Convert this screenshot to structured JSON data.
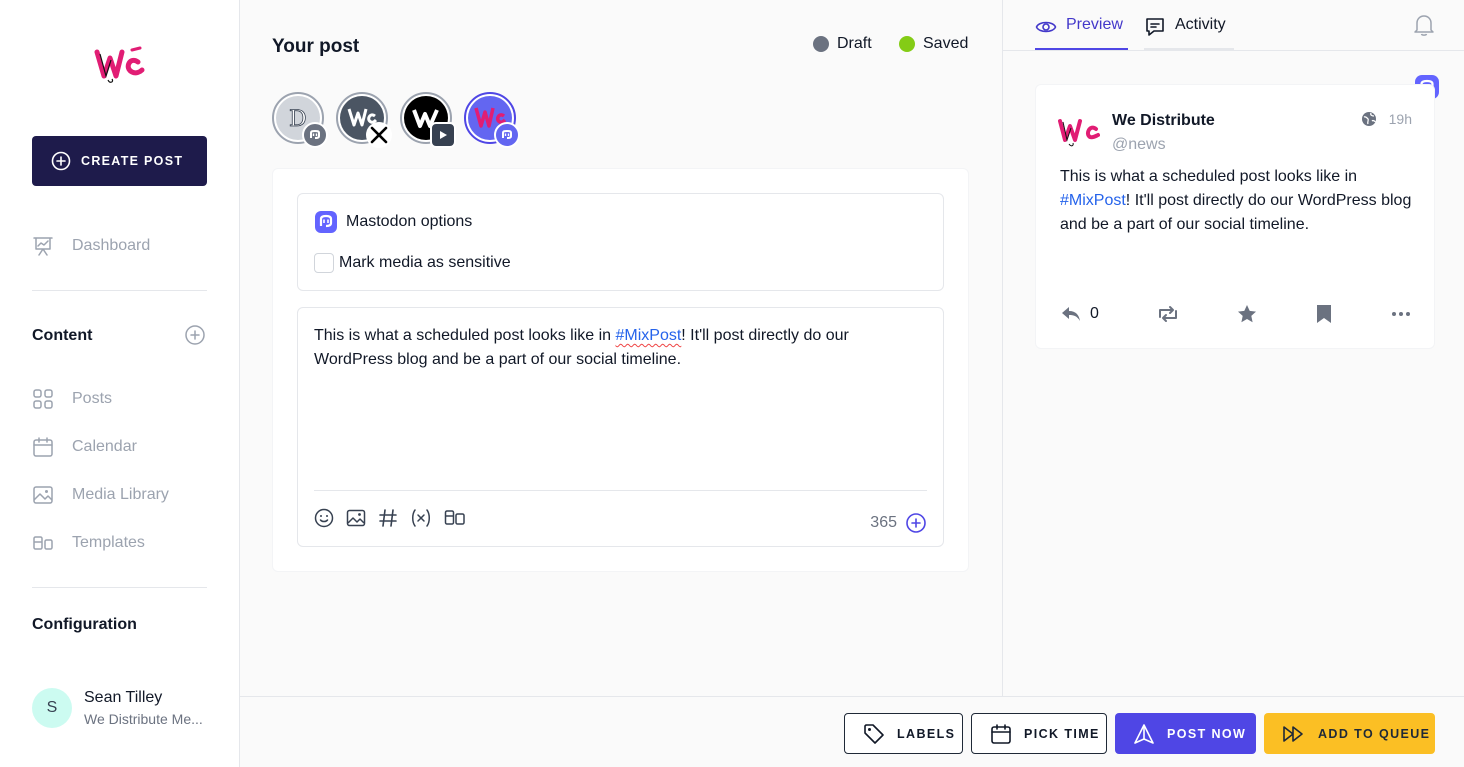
{
  "sidebar": {
    "create_post": "CREATE POST",
    "dashboard": "Dashboard",
    "content_title": "Content",
    "items": [
      {
        "label": "Posts"
      },
      {
        "label": "Calendar"
      },
      {
        "label": "Media Library"
      },
      {
        "label": "Templates"
      }
    ],
    "configuration_title": "Configuration",
    "user": {
      "initial": "S",
      "name": "Sean Tilley",
      "org": "We Distribute Me..."
    }
  },
  "main": {
    "title": "Your post",
    "status_draft": "Draft",
    "status_saved": "Saved",
    "colors": {
      "draft": "#6b7280",
      "saved": "#84cc16",
      "accent": "#4f46e5"
    },
    "accounts": [
      {
        "icon": "d-logo",
        "platform": "mastodon",
        "selected": false
      },
      {
        "icon": "we-logo-bw",
        "platform": "x",
        "selected": false
      },
      {
        "icon": "w-logo-black",
        "platform": "youtube",
        "selected": false
      },
      {
        "icon": "we-logo-pink",
        "platform": "mastodon",
        "selected": true
      }
    ],
    "options": {
      "title": "Mastodon options",
      "sensitive_label": "Mark media as sensitive",
      "sensitive_checked": false
    },
    "editor": {
      "text_before": "This is what a scheduled post looks like in ",
      "hashtag": "#MixPost",
      "text_after": "! It'll post directly do our WordPress blog and be a part of our social timeline.",
      "char_count": "365"
    }
  },
  "right": {
    "tab_preview": "Preview",
    "tab_activity": "Activity",
    "preview": {
      "name": "We Distribute",
      "handle": "@news",
      "time": "19h",
      "text_before": "This is what a scheduled post looks like in ",
      "hashtag": "#MixPost",
      "text_after": "! It'll post directly do our WordPress blog and be a part of our social timeline.",
      "replies": "0"
    }
  },
  "bottom": {
    "labels": "LABELS",
    "pick_time": "PICK TIME",
    "post_now": "POST NOW",
    "add_to_queue": "ADD TO QUEUE"
  }
}
